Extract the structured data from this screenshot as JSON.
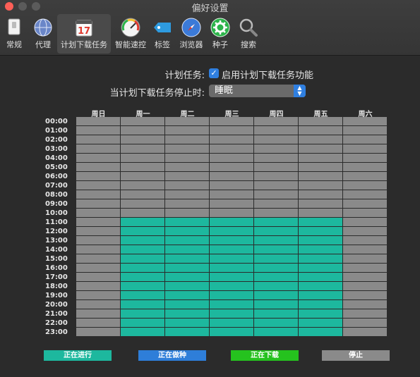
{
  "window": {
    "title": "偏好设置"
  },
  "toolbar": {
    "items": [
      {
        "label": "常规",
        "icon": "switch-icon"
      },
      {
        "label": "代理",
        "icon": "globe-icon"
      },
      {
        "label": "计划下载任务",
        "icon": "calendar-icon",
        "calendar_day": "17",
        "active": true
      },
      {
        "label": "智能速控",
        "icon": "gauge-icon"
      },
      {
        "label": "标签",
        "icon": "tag-icon"
      },
      {
        "label": "浏览器",
        "icon": "compass-icon"
      },
      {
        "label": "种子",
        "icon": "gear-icon"
      },
      {
        "label": "搜索",
        "icon": "search-icon"
      }
    ]
  },
  "schedule": {
    "task_label": "计划任务:",
    "enable_checked": true,
    "enable_label": "启用计划下载任务功能",
    "stop_label": "当计划下载任务停止时:",
    "stop_value": "睡眠"
  },
  "grid": {
    "days": [
      "周日",
      "周一",
      "周二",
      "周三",
      "周四",
      "周五",
      "周六"
    ],
    "hours": [
      "00:00",
      "01:00",
      "02:00",
      "03:00",
      "04:00",
      "05:00",
      "06:00",
      "07:00",
      "08:00",
      "09:00",
      "10:00",
      "11:00",
      "12:00",
      "13:00",
      "14:00",
      "15:00",
      "16:00",
      "17:00",
      "18:00",
      "19:00",
      "20:00",
      "21:00",
      "22:00",
      "23:00"
    ],
    "active_days": [
      1,
      2,
      3,
      4,
      5
    ],
    "active_hours": [
      11,
      12,
      13,
      14,
      15,
      16,
      17,
      18,
      19,
      20,
      21,
      22,
      23
    ]
  },
  "legend": [
    {
      "label": "正在进行",
      "color": "#1db89e"
    },
    {
      "label": "正在做种",
      "color": "#2e7ed9"
    },
    {
      "label": "正在下载",
      "color": "#25c21e"
    },
    {
      "label": "停止",
      "color": "#8a8a8a"
    }
  ],
  "colors": {
    "active": "#1db89e",
    "idle": "#8a8a8a"
  }
}
